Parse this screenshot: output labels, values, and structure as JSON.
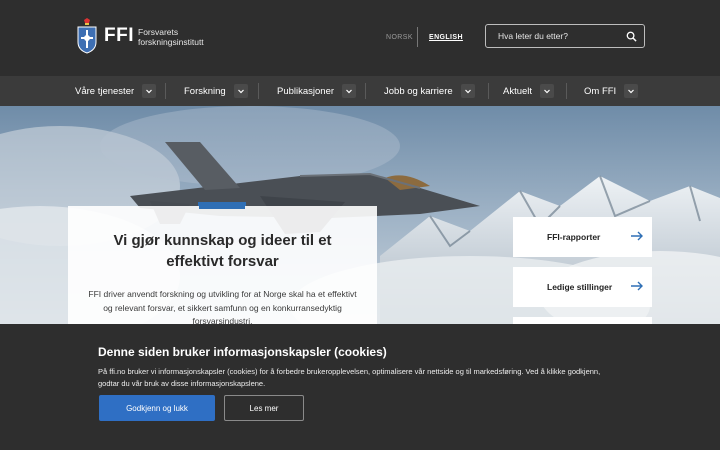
{
  "header": {
    "logo_abbr": "FFI",
    "logo_line1": "Forsvarets",
    "logo_line2": "forskningsinstitutt",
    "lang_norsk": "NORSK",
    "lang_english": "ENGLISH",
    "search_placeholder": "Hva leter du etter?"
  },
  "nav": {
    "items": [
      {
        "label": "Våre tjenester"
      },
      {
        "label": "Forskning"
      },
      {
        "label": "Publikasjoner"
      },
      {
        "label": "Jobb og karriere"
      },
      {
        "label": "Aktuelt"
      },
      {
        "label": "Om FFI"
      }
    ]
  },
  "hero": {
    "title": "Vi gjør kunnskap og ideer til et effektivt forsvar",
    "text": "FFI driver anvendt forskning og utvikling for at Norge skal ha et effektivt og relevant forsvar, et sikkert samfunn og en konkurransedyktig forsvarsindustri.",
    "links": [
      {
        "label": "FFI-rapporter"
      },
      {
        "label": "Ledige stillinger"
      }
    ]
  },
  "cookie": {
    "title": "Denne siden bruker informasjonskapsler (cookies)",
    "text": "På ffi.no bruker vi informasjonskapsler (cookies) for å forbedre brukeropplevelsen, optimalisere vår nettside og til markedsføring. Ved å klikke godkjenn, godtar du vår bruk av disse informasjonskapslene.",
    "accept_label": "Godkjenn og lukk",
    "more_label": "Les mer"
  },
  "colors": {
    "header_bg": "#2e2e2e",
    "nav_bg": "#3b3b3b",
    "accent_blue": "#2f6fc4"
  }
}
